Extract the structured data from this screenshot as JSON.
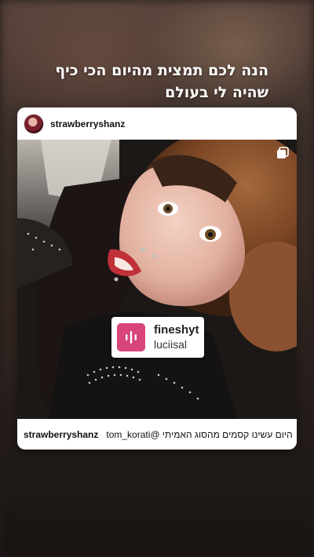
{
  "story": {
    "caption": "הנה לכם תמצית מהיום הכי כיף שהיה לי בעולם"
  },
  "post": {
    "username": "strawberryshanz",
    "multi_icon": "carousel-icon",
    "music": {
      "title": "fineshyt",
      "artist": "luciisal",
      "icon": "audio-waveform-icon",
      "icon_color": "#d8457a"
    },
    "footer": {
      "username": "strawberryshanz",
      "text": "היום עשינו קסמים מהסוג האמיתי @tom_korati"
    }
  }
}
